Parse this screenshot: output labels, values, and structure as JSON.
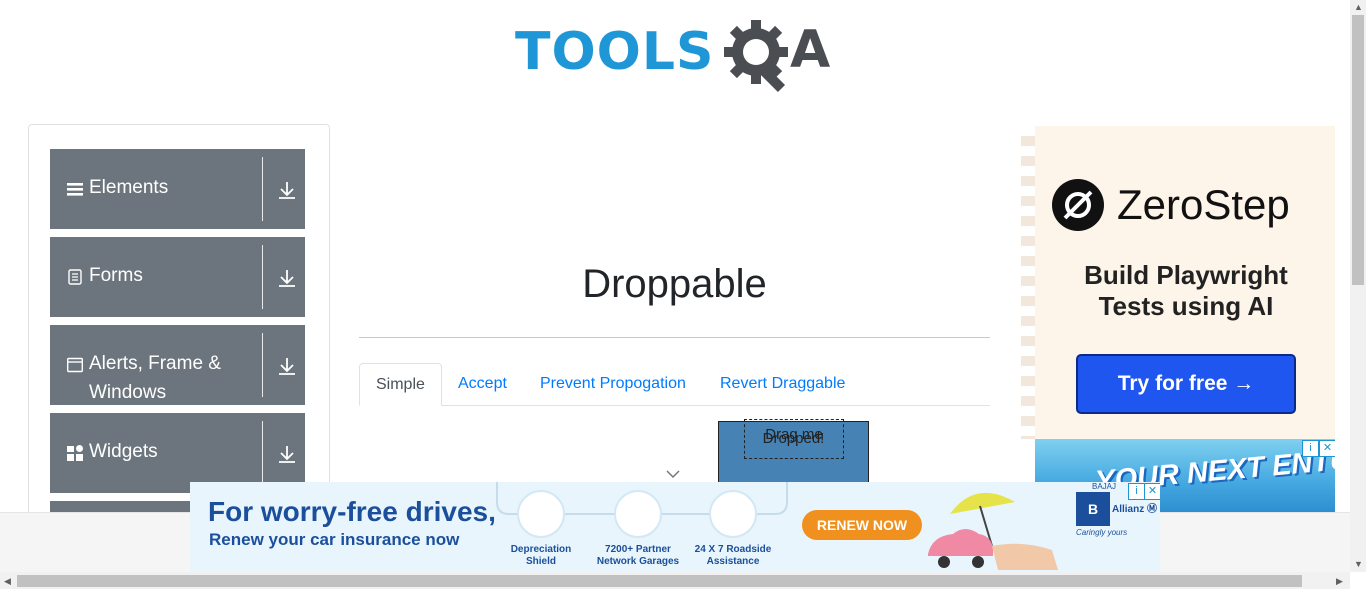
{
  "header": {
    "logo_main": "TOOLS",
    "logo_q": "Q",
    "logo_a": "A"
  },
  "sidebar": {
    "groups": [
      {
        "label": "Elements",
        "icon": "list-icon"
      },
      {
        "label": "Forms",
        "icon": "document-icon"
      },
      {
        "label": "Alerts, Frame & Windows",
        "icon": "window-icon"
      },
      {
        "label": "Widgets",
        "icon": "widgets-icon"
      }
    ]
  },
  "main": {
    "title": "Droppable",
    "tabs": [
      {
        "label": "Simple",
        "active": true
      },
      {
        "label": "Accept",
        "active": false
      },
      {
        "label": "Prevent Propogation",
        "active": false
      },
      {
        "label": "Revert Draggable",
        "active": false
      }
    ],
    "drag_label": "Drag me",
    "drop_label": "Dropped!"
  },
  "ad_right": {
    "brand": "ZeroStep",
    "headline": "Build Playwright Tests using AI",
    "button": "Try for free →"
  },
  "ad_small": {
    "text": "YOUR NEXT ENTURE"
  },
  "ad_bottom": {
    "headline": "For worry-free drives,",
    "sub": "Renew your car insurance now",
    "features": [
      "Depreciation Shield",
      "7200+ Partner Network Garages",
      "24 X 7 Roadside Assistance"
    ],
    "cta": "RENEW NOW",
    "brand": "BAJAJ",
    "partner": "Allianz Ⓜ",
    "tagline": "Caringly yours"
  },
  "colors": {
    "accent": "#1f96d6",
    "sidebar": "#6c757d",
    "link": "#007bff",
    "drop": "#4682b4"
  }
}
